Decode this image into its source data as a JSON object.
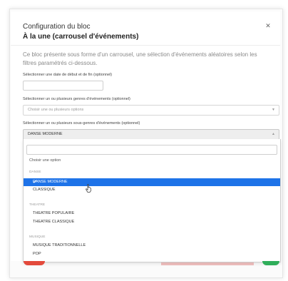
{
  "modal": {
    "title": "Configuration du bloc",
    "subtitle": "À la une (carrousel d'événements)",
    "close_icon": "close-icon",
    "description": "Ce bloc présente sous forme d'un carrousel, une sélection d'événements aléatoires selon les filtres paramétrés ci-dessous."
  },
  "date_filter": {
    "label": "Sélectionner une date de début et de fin (optionnel)",
    "value": ""
  },
  "genres": {
    "label": "Sélectionner un ou plusieurs genres d'événements (optionnel)",
    "placeholder": "Choisir une ou plusieurs options"
  },
  "subgenres": {
    "label": "Sélectionner un ou plusieurs sous-genres d'événements (optionnel)",
    "selected_value": "DANSE MODERNE",
    "search_value": "",
    "first_option": "Choisir une option",
    "groups": [
      {
        "name": "DANSE",
        "options": [
          "DANSE MODERNE",
          "CLASSIQUE"
        ]
      },
      {
        "name": "THEATRE",
        "options": [
          "THEATRE POPULAIRE",
          "THEATRE CLASSIQUE"
        ]
      },
      {
        "name": "MUSIQUE",
        "options": [
          "MUSIQUE TRADITIONNELLE",
          "POP"
        ]
      }
    ],
    "highlighted_option": "DANSE MODERNE"
  },
  "colors": {
    "highlight": "#1e73e8",
    "danger": "#e34a3c",
    "success": "#2fae5a"
  }
}
